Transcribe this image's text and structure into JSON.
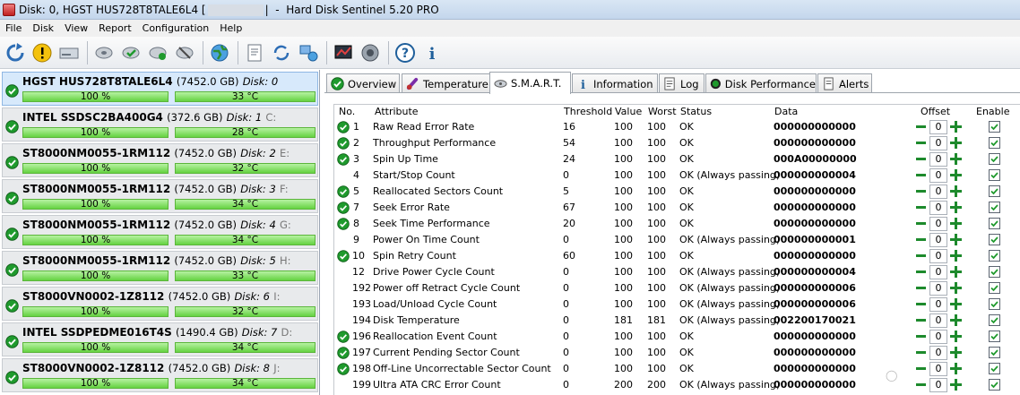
{
  "window": {
    "title_prefix": "Disk: 0, HGST HUS728T8TALE6L4 [",
    "title_suffix": "|  -  Hard Disk Sentinel 5.20 PRO"
  },
  "menu": [
    {
      "name": "File"
    },
    {
      "name": "Disk"
    },
    {
      "name": "View"
    },
    {
      "name": "Report"
    },
    {
      "name": "Configuration"
    },
    {
      "name": "Help"
    }
  ],
  "toolbar": {
    "icons": [
      "refresh-icon",
      "alert-icon",
      "drive-icon",
      "disk-tool-icon",
      "disk-check-icon",
      "disk-ok-icon",
      "disk-repair-icon",
      "web-icon",
      "document-icon",
      "sync-icon",
      "network-icon",
      "chart-icon",
      "speaker-icon",
      "help-icon",
      "info-icon"
    ]
  },
  "disks": [
    {
      "model": "HGST HUS728T8TALE6L4",
      "capacity": "(7452.0 GB)",
      "index": "Disk: 0",
      "drive": "",
      "health": "100 %",
      "temperature": "33 °C",
      "selected": true
    },
    {
      "model": "INTEL SSDSC2BA400G4",
      "capacity": "(372.6 GB)",
      "index": "Disk: 1",
      "drive": "C:",
      "health": "100 %",
      "temperature": "28 °C"
    },
    {
      "model": "ST8000NM0055-1RM112",
      "capacity": "(7452.0 GB)",
      "index": "Disk: 2",
      "drive": "E:",
      "health": "100 %",
      "temperature": "32 °C"
    },
    {
      "model": "ST8000NM0055-1RM112",
      "capacity": "(7452.0 GB)",
      "index": "Disk: 3",
      "drive": "F:",
      "health": "100 %",
      "temperature": "34 °C"
    },
    {
      "model": "ST8000NM0055-1RM112",
      "capacity": "(7452.0 GB)",
      "index": "Disk: 4",
      "drive": "G:",
      "health": "100 %",
      "temperature": "34 °C"
    },
    {
      "model": "ST8000NM0055-1RM112",
      "capacity": "(7452.0 GB)",
      "index": "Disk: 5",
      "drive": "H:",
      "health": "100 %",
      "temperature": "33 °C"
    },
    {
      "model": "ST8000VN0002-1Z8112",
      "capacity": "(7452.0 GB)",
      "index": "Disk: 6",
      "drive": "I:",
      "health": "100 %",
      "temperature": "32 °C"
    },
    {
      "model": "INTEL SSDPEDME016T4S",
      "capacity": "(1490.4 GB)",
      "index": "Disk: 7",
      "drive": "D:",
      "health": "100 %",
      "temperature": "34 °C"
    },
    {
      "model": "ST8000VN0002-1Z8112",
      "capacity": "(7452.0 GB)",
      "index": "Disk: 8",
      "drive": "J:",
      "health": "100 %",
      "temperature": "34 °C"
    }
  ],
  "tabs": [
    {
      "label": "Overview",
      "icon": "check-icon"
    },
    {
      "label": "Temperature",
      "icon": "thermometer-icon"
    },
    {
      "label": "S.M.A.R.T.",
      "icon": "smart-icon",
      "active": true
    },
    {
      "label": "Information",
      "icon": "info-icon"
    },
    {
      "label": "Log",
      "icon": "log-icon"
    },
    {
      "label": "Disk Performance",
      "icon": "gauge-icon"
    },
    {
      "label": "Alerts",
      "icon": "alerts-icon"
    }
  ],
  "smart": {
    "columns": {
      "no": "No.",
      "attribute": "Attribute",
      "threshold": "Threshold",
      "value": "Value",
      "worst": "Worst",
      "status": "Status",
      "data": "Data",
      "offset": "Offset",
      "enable": "Enable"
    },
    "rows": [
      {
        "no": "1",
        "attribute": "Raw Read Error Rate",
        "threshold": "16",
        "value": "100",
        "worst": "100",
        "status": "OK",
        "data": "000000000000",
        "offset": "0",
        "icon": true
      },
      {
        "no": "2",
        "attribute": "Throughput Performance",
        "threshold": "54",
        "value": "100",
        "worst": "100",
        "status": "OK",
        "data": "000000000000",
        "offset": "0",
        "icon": true
      },
      {
        "no": "3",
        "attribute": "Spin Up Time",
        "threshold": "24",
        "value": "100",
        "worst": "100",
        "status": "OK",
        "data": "000A00000000",
        "offset": "0",
        "icon": true
      },
      {
        "no": "4",
        "attribute": "Start/Stop Count",
        "threshold": "0",
        "value": "100",
        "worst": "100",
        "status": "OK (Always passing)",
        "data": "000000000004",
        "offset": "0",
        "icon": false
      },
      {
        "no": "5",
        "attribute": "Reallocated Sectors Count",
        "threshold": "5",
        "value": "100",
        "worst": "100",
        "status": "OK",
        "data": "000000000000",
        "offset": "0",
        "icon": true
      },
      {
        "no": "7",
        "attribute": "Seek Error Rate",
        "threshold": "67",
        "value": "100",
        "worst": "100",
        "status": "OK",
        "data": "000000000000",
        "offset": "0",
        "icon": true
      },
      {
        "no": "8",
        "attribute": "Seek Time Performance",
        "threshold": "20",
        "value": "100",
        "worst": "100",
        "status": "OK",
        "data": "000000000000",
        "offset": "0",
        "icon": true
      },
      {
        "no": "9",
        "attribute": "Power On Time Count",
        "threshold": "0",
        "value": "100",
        "worst": "100",
        "status": "OK (Always passing)",
        "data": "000000000001",
        "offset": "0",
        "icon": false
      },
      {
        "no": "10",
        "attribute": "Spin Retry Count",
        "threshold": "60",
        "value": "100",
        "worst": "100",
        "status": "OK",
        "data": "000000000000",
        "offset": "0",
        "icon": true
      },
      {
        "no": "12",
        "attribute": "Drive Power Cycle Count",
        "threshold": "0",
        "value": "100",
        "worst": "100",
        "status": "OK (Always passing)",
        "data": "000000000004",
        "offset": "0",
        "icon": false
      },
      {
        "no": "192",
        "attribute": "Power off Retract Cycle Count",
        "threshold": "0",
        "value": "100",
        "worst": "100",
        "status": "OK (Always passing)",
        "data": "000000000006",
        "offset": "0",
        "icon": false
      },
      {
        "no": "193",
        "attribute": "Load/Unload Cycle Count",
        "threshold": "0",
        "value": "100",
        "worst": "100",
        "status": "OK (Always passing)",
        "data": "000000000006",
        "offset": "0",
        "icon": false
      },
      {
        "no": "194",
        "attribute": "Disk Temperature",
        "threshold": "0",
        "value": "181",
        "worst": "181",
        "status": "OK (Always passing)",
        "data": "002200170021",
        "offset": "0",
        "icon": false
      },
      {
        "no": "196",
        "attribute": "Reallocation Event Count",
        "threshold": "0",
        "value": "100",
        "worst": "100",
        "status": "OK",
        "data": "000000000000",
        "offset": "0",
        "icon": true
      },
      {
        "no": "197",
        "attribute": "Current Pending Sector Count",
        "threshold": "0",
        "value": "100",
        "worst": "100",
        "status": "OK",
        "data": "000000000000",
        "offset": "0",
        "icon": true
      },
      {
        "no": "198",
        "attribute": "Off-Line Uncorrectable Sector Count",
        "threshold": "0",
        "value": "100",
        "worst": "100",
        "status": "OK",
        "data": "000000000000",
        "offset": "0",
        "icon": true
      },
      {
        "no": "199",
        "attribute": "Ultra ATA CRC Error Count",
        "threshold": "0",
        "value": "200",
        "worst": "200",
        "status": "OK (Always passing)",
        "data": "000000000000",
        "offset": "0",
        "icon": false
      }
    ]
  },
  "colors": {
    "ok_green": "#1f9a2d",
    "bar_green": "#65d241",
    "selected_bg": "#d7e9fb"
  }
}
